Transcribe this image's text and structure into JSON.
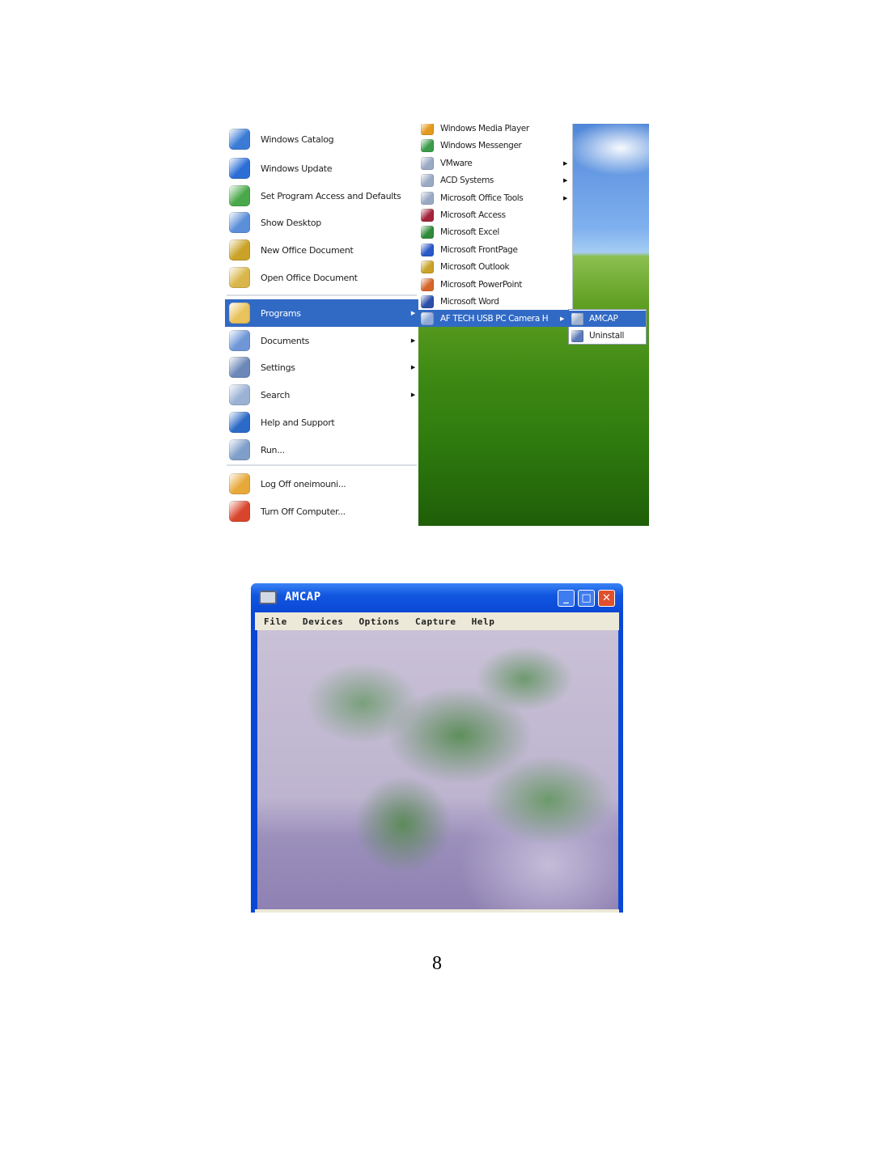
{
  "start_menu": {
    "pinned": [
      {
        "label": "Windows Catalog",
        "icon": "windows-catalog-icon",
        "color": "#3a7bd5"
      },
      {
        "label": "Windows Update",
        "icon": "windows-update-icon",
        "color": "#2b6fd6"
      },
      {
        "label": "Set Program Access and Defaults",
        "icon": "program-access-icon",
        "color": "#4aa84a"
      },
      {
        "label": "Show Desktop",
        "icon": "show-desktop-icon",
        "color": "#5b8fd9"
      },
      {
        "label": "New Office Document",
        "icon": "new-office-document-icon",
        "color": "#c9a227"
      },
      {
        "label": "Open Office Document",
        "icon": "open-office-document-icon",
        "color": "#d8b64a"
      }
    ],
    "main": [
      {
        "label": "Programs",
        "icon": "programs-icon",
        "color": "#e8c25a",
        "arrow": true
      },
      {
        "label": "Documents",
        "icon": "documents-icon",
        "color": "#6f97d8",
        "arrow": true
      },
      {
        "label": "Settings",
        "icon": "settings-icon",
        "color": "#6b88b8",
        "arrow": true
      },
      {
        "label": "Search",
        "icon": "search-icon",
        "color": "#9bb2d4",
        "arrow": true
      },
      {
        "label": "Help and Support",
        "icon": "help-icon",
        "color": "#2c6ac8",
        "arrow": false
      },
      {
        "label": "Run...",
        "icon": "run-icon",
        "color": "#7f9ec9",
        "arrow": false
      }
    ],
    "footer": [
      {
        "label": "Log Off oneimouni...",
        "icon": "log-off-icon",
        "color": "#e7a93a"
      },
      {
        "label": "Turn Off Computer...",
        "icon": "power-icon",
        "color": "#d9452c"
      }
    ],
    "programs_menu": [
      {
        "label": "Windows Media Player",
        "icon": "media-player-icon",
        "color": "#e39a1e",
        "arrow": false
      },
      {
        "label": "Windows Messenger",
        "icon": "messenger-icon",
        "color": "#3b9b4a",
        "arrow": false
      },
      {
        "label": "VMware",
        "icon": "folder-icon",
        "color": "#9aa9c4",
        "arrow": true
      },
      {
        "label": "ACD Systems",
        "icon": "folder-icon",
        "color": "#9aa9c4",
        "arrow": true
      },
      {
        "label": "Microsoft Office Tools",
        "icon": "folder-icon",
        "color": "#9aa9c4",
        "arrow": true
      },
      {
        "label": "Microsoft Access",
        "icon": "access-icon",
        "color": "#a3243a",
        "arrow": false
      },
      {
        "label": "Microsoft Excel",
        "icon": "excel-icon",
        "color": "#2f8a3a",
        "arrow": false
      },
      {
        "label": "Microsoft FrontPage",
        "icon": "frontpage-icon",
        "color": "#2a58c8",
        "arrow": false
      },
      {
        "label": "Microsoft Outlook",
        "icon": "outlook-icon",
        "color": "#c9a227",
        "arrow": false
      },
      {
        "label": "Microsoft PowerPoint",
        "icon": "powerpoint-icon",
        "color": "#d6652a",
        "arrow": false
      },
      {
        "label": "Microsoft Word",
        "icon": "word-icon",
        "color": "#2b4fa8",
        "arrow": false
      },
      {
        "label": "AF TECH USB PC Camera H",
        "icon": "folder-icon",
        "color": "#8fa8d8",
        "arrow": true
      }
    ],
    "submenu": [
      {
        "label": "AMCAP",
        "icon": "amcap-icon",
        "color": "#9fb1cf"
      },
      {
        "label": "Uninstall",
        "icon": "uninstall-icon",
        "color": "#5a79b8"
      }
    ]
  },
  "amcap_window": {
    "title": "AMCAP",
    "menu": [
      "File",
      "Devices",
      "Options",
      "Capture",
      "Help"
    ],
    "buttons": {
      "minimize": "_",
      "maximize": "□",
      "close": "✕"
    }
  },
  "page_number": "8"
}
